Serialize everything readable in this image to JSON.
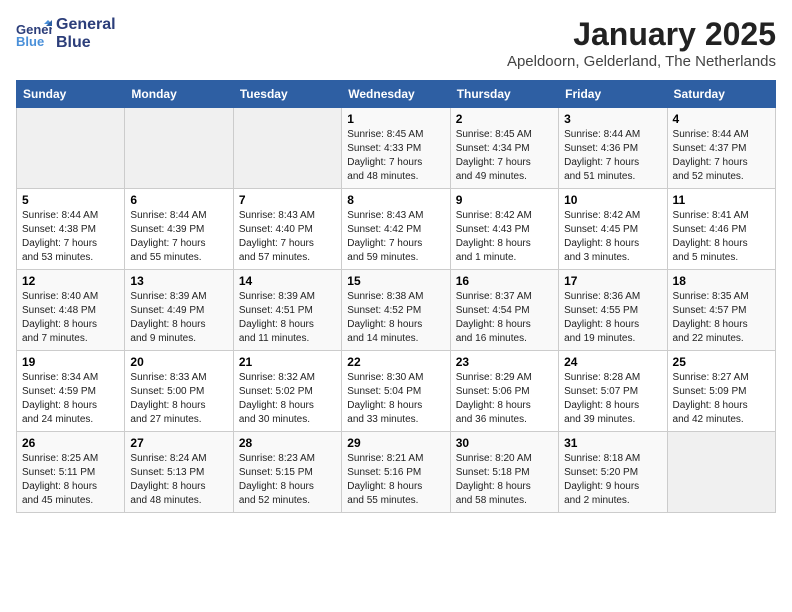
{
  "logo": {
    "line1": "General",
    "line2": "Blue"
  },
  "title": "January 2025",
  "location": "Apeldoorn, Gelderland, The Netherlands",
  "weekdays": [
    "Sunday",
    "Monday",
    "Tuesday",
    "Wednesday",
    "Thursday",
    "Friday",
    "Saturday"
  ],
  "weeks": [
    [
      {
        "day": "",
        "info": ""
      },
      {
        "day": "",
        "info": ""
      },
      {
        "day": "",
        "info": ""
      },
      {
        "day": "1",
        "info": "Sunrise: 8:45 AM\nSunset: 4:33 PM\nDaylight: 7 hours\nand 48 minutes."
      },
      {
        "day": "2",
        "info": "Sunrise: 8:45 AM\nSunset: 4:34 PM\nDaylight: 7 hours\nand 49 minutes."
      },
      {
        "day": "3",
        "info": "Sunrise: 8:44 AM\nSunset: 4:36 PM\nDaylight: 7 hours\nand 51 minutes."
      },
      {
        "day": "4",
        "info": "Sunrise: 8:44 AM\nSunset: 4:37 PM\nDaylight: 7 hours\nand 52 minutes."
      }
    ],
    [
      {
        "day": "5",
        "info": "Sunrise: 8:44 AM\nSunset: 4:38 PM\nDaylight: 7 hours\nand 53 minutes."
      },
      {
        "day": "6",
        "info": "Sunrise: 8:44 AM\nSunset: 4:39 PM\nDaylight: 7 hours\nand 55 minutes."
      },
      {
        "day": "7",
        "info": "Sunrise: 8:43 AM\nSunset: 4:40 PM\nDaylight: 7 hours\nand 57 minutes."
      },
      {
        "day": "8",
        "info": "Sunrise: 8:43 AM\nSunset: 4:42 PM\nDaylight: 7 hours\nand 59 minutes."
      },
      {
        "day": "9",
        "info": "Sunrise: 8:42 AM\nSunset: 4:43 PM\nDaylight: 8 hours\nand 1 minute."
      },
      {
        "day": "10",
        "info": "Sunrise: 8:42 AM\nSunset: 4:45 PM\nDaylight: 8 hours\nand 3 minutes."
      },
      {
        "day": "11",
        "info": "Sunrise: 8:41 AM\nSunset: 4:46 PM\nDaylight: 8 hours\nand 5 minutes."
      }
    ],
    [
      {
        "day": "12",
        "info": "Sunrise: 8:40 AM\nSunset: 4:48 PM\nDaylight: 8 hours\nand 7 minutes."
      },
      {
        "day": "13",
        "info": "Sunrise: 8:39 AM\nSunset: 4:49 PM\nDaylight: 8 hours\nand 9 minutes."
      },
      {
        "day": "14",
        "info": "Sunrise: 8:39 AM\nSunset: 4:51 PM\nDaylight: 8 hours\nand 11 minutes."
      },
      {
        "day": "15",
        "info": "Sunrise: 8:38 AM\nSunset: 4:52 PM\nDaylight: 8 hours\nand 14 minutes."
      },
      {
        "day": "16",
        "info": "Sunrise: 8:37 AM\nSunset: 4:54 PM\nDaylight: 8 hours\nand 16 minutes."
      },
      {
        "day": "17",
        "info": "Sunrise: 8:36 AM\nSunset: 4:55 PM\nDaylight: 8 hours\nand 19 minutes."
      },
      {
        "day": "18",
        "info": "Sunrise: 8:35 AM\nSunset: 4:57 PM\nDaylight: 8 hours\nand 22 minutes."
      }
    ],
    [
      {
        "day": "19",
        "info": "Sunrise: 8:34 AM\nSunset: 4:59 PM\nDaylight: 8 hours\nand 24 minutes."
      },
      {
        "day": "20",
        "info": "Sunrise: 8:33 AM\nSunset: 5:00 PM\nDaylight: 8 hours\nand 27 minutes."
      },
      {
        "day": "21",
        "info": "Sunrise: 8:32 AM\nSunset: 5:02 PM\nDaylight: 8 hours\nand 30 minutes."
      },
      {
        "day": "22",
        "info": "Sunrise: 8:30 AM\nSunset: 5:04 PM\nDaylight: 8 hours\nand 33 minutes."
      },
      {
        "day": "23",
        "info": "Sunrise: 8:29 AM\nSunset: 5:06 PM\nDaylight: 8 hours\nand 36 minutes."
      },
      {
        "day": "24",
        "info": "Sunrise: 8:28 AM\nSunset: 5:07 PM\nDaylight: 8 hours\nand 39 minutes."
      },
      {
        "day": "25",
        "info": "Sunrise: 8:27 AM\nSunset: 5:09 PM\nDaylight: 8 hours\nand 42 minutes."
      }
    ],
    [
      {
        "day": "26",
        "info": "Sunrise: 8:25 AM\nSunset: 5:11 PM\nDaylight: 8 hours\nand 45 minutes."
      },
      {
        "day": "27",
        "info": "Sunrise: 8:24 AM\nSunset: 5:13 PM\nDaylight: 8 hours\nand 48 minutes."
      },
      {
        "day": "28",
        "info": "Sunrise: 8:23 AM\nSunset: 5:15 PM\nDaylight: 8 hours\nand 52 minutes."
      },
      {
        "day": "29",
        "info": "Sunrise: 8:21 AM\nSunset: 5:16 PM\nDaylight: 8 hours\nand 55 minutes."
      },
      {
        "day": "30",
        "info": "Sunrise: 8:20 AM\nSunset: 5:18 PM\nDaylight: 8 hours\nand 58 minutes."
      },
      {
        "day": "31",
        "info": "Sunrise: 8:18 AM\nSunset: 5:20 PM\nDaylight: 9 hours\nand 2 minutes."
      },
      {
        "day": "",
        "info": ""
      }
    ]
  ]
}
